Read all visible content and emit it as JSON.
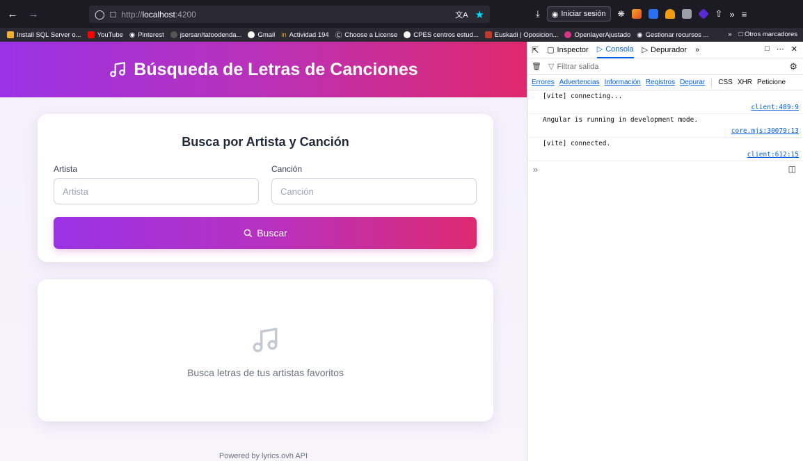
{
  "browser": {
    "url_prefix": "http://",
    "url_host": "localhost",
    "url_port": ":4200",
    "signin_label": "Iniciar sesión",
    "bookmarks": [
      "Install SQL Server o...",
      "YouTube",
      "Pinterest",
      "jsersan/tatoodenda...",
      "Gmail",
      "Actividad 194",
      "Choose a License",
      "CPES centros estud...",
      "Euskadi | Oposicion...",
      "OpenlayerAjustado",
      "Gestionar recursos ..."
    ],
    "other_bookmarks": "Otros marcadores"
  },
  "app": {
    "title": "Búsqueda de Letras de Canciones",
    "search_card_title": "Busca por Artista y Canción",
    "artist_label": "Artista",
    "artist_placeholder": "Artista",
    "song_label": "Canción",
    "song_placeholder": "Canción",
    "search_button": "Buscar",
    "empty_text": "Busca letras de tus artistas favoritos",
    "footer": "Powered by lyrics.ovh API",
    "colors": {
      "gradient_start": "#9a33e6",
      "gradient_end": "#e0296c"
    }
  },
  "devtools": {
    "tabs": {
      "inspector": "Inspector",
      "console": "Consola",
      "debugger": "Depurador"
    },
    "filter_placeholder": "Filtrar salida",
    "levels": [
      "Errores",
      "Advertencias",
      "Información",
      "Registros",
      "Depurar"
    ],
    "extra_filters": [
      "CSS",
      "XHR",
      "Peticione"
    ],
    "logs": [
      {
        "msg": "[vite] connecting...",
        "src": "client:489:9"
      },
      {
        "msg": "Angular is running in development mode.",
        "src": "core.mjs:30079:13"
      },
      {
        "msg": "[vite] connected.",
        "src": "client:612:15"
      }
    ]
  }
}
